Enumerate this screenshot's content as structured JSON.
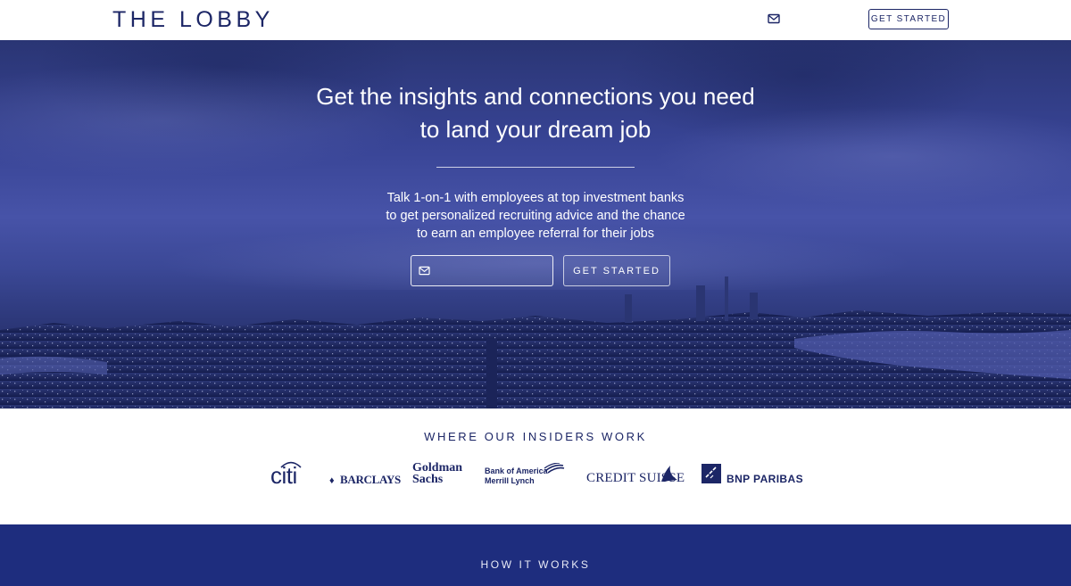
{
  "header": {
    "logo": "THE LOBBY",
    "mail_icon": "envelope-icon",
    "cta_label": "GET STARTED"
  },
  "hero": {
    "title_line1": "Get the insights and connections you need",
    "title_line2": "to land your dream job",
    "subtitle_line1": "Talk 1-on-1 with employees at top investment banks",
    "subtitle_line2": "to get personalized recruiting advice and the chance",
    "subtitle_line3": "to earn an employee referral for their jobs",
    "email_value": "",
    "email_icon": "envelope-icon",
    "cta_label": "GET STARTED"
  },
  "insiders": {
    "title": "WHERE OUR INSIDERS WORK",
    "banks": {
      "citi": "citi",
      "barclays": "BARCLAYS",
      "goldman_line1": "Goldman",
      "goldman_line2": "Sachs",
      "boa_line1": "Bank of America",
      "boa_line2": "Merrill Lynch",
      "credit_suisse": "CREDIT SUISSE",
      "bnp": "BNP PARIBAS"
    }
  },
  "how_it_works": {
    "title": "HOW IT WORKS"
  },
  "colors": {
    "brand_navy": "#1c2666",
    "how_bg": "#1e2d7e"
  }
}
